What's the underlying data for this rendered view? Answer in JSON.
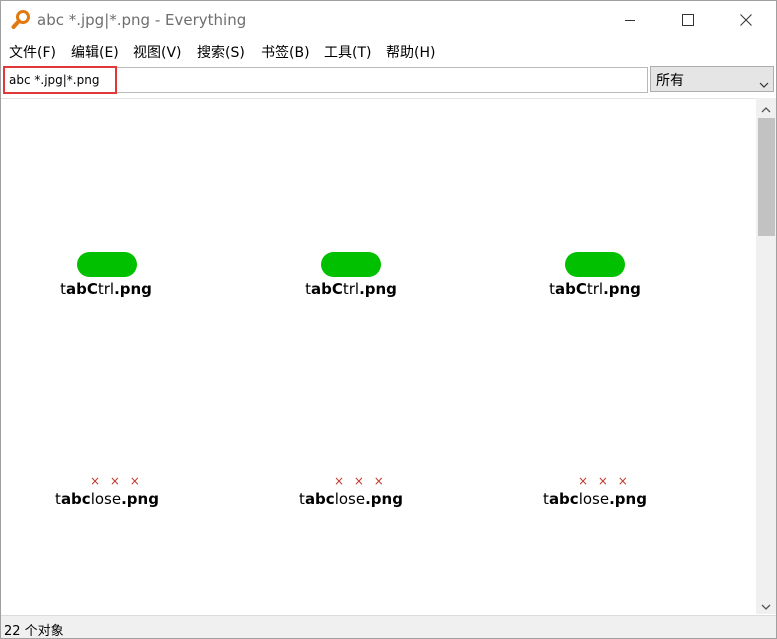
{
  "window": {
    "title": "abc *.jpg|*.png - Everything",
    "controls": {
      "minimize": "minimize-icon",
      "maximize": "maximize-icon",
      "close": "close-icon"
    }
  },
  "menu": {
    "items": [
      "文件(F)",
      "编辑(E)",
      "视图(V)",
      "搜索(S)",
      "书签(B)",
      "工具(T)",
      "帮助(H)"
    ]
  },
  "search": {
    "value": "abc *.jpg|*.png",
    "filter_selected": "所有"
  },
  "results": {
    "items": [
      {
        "name": "tabCtrl.png",
        "parts": [
          "t",
          "abC",
          "trl",
          ".png"
        ],
        "thumbnail": "green-pill"
      },
      {
        "name": "tabCtrl.png",
        "parts": [
          "t",
          "abC",
          "trl",
          ".png"
        ],
        "thumbnail": "green-pill"
      },
      {
        "name": "tabCtrl.png",
        "parts": [
          "t",
          "abC",
          "trl",
          ".png"
        ],
        "thumbnail": "green-pill"
      },
      {
        "name": "tabclose.png",
        "parts": [
          "t",
          "abc",
          "lose",
          ".png"
        ],
        "thumbnail": "close-x-icons",
        "thumb_text": "× × ×"
      },
      {
        "name": "tabclose.png",
        "parts": [
          "t",
          "abc",
          "lose",
          ".png"
        ],
        "thumbnail": "close-x-icons",
        "thumb_text": "× × ×"
      },
      {
        "name": "tabclose.png",
        "parts": [
          "t",
          "abc",
          "lose",
          ".png"
        ],
        "thumbnail": "close-x-icons",
        "thumb_text": "× × ×"
      }
    ]
  },
  "status": {
    "text": "22 个对象"
  },
  "colors": {
    "highlight_box": "#e0393a",
    "pill_green": "#00c000",
    "x_red": "#c0392b",
    "title_gray": "#6e6e6e"
  }
}
